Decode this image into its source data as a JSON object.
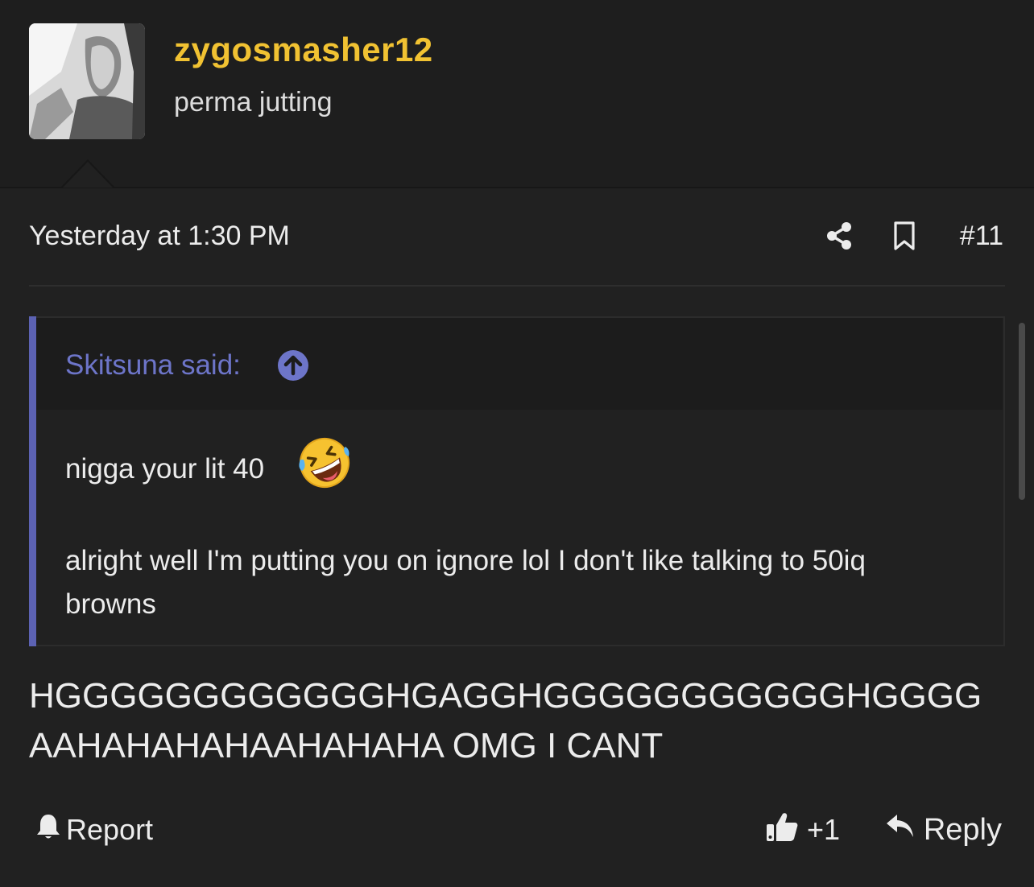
{
  "user": {
    "username": "zygosmasher12",
    "title": "perma jutting"
  },
  "post": {
    "timestamp": "Yesterday at 1:30 PM",
    "number": "#11",
    "body": "HGGGGGGGGGGGGHGAGGHGGGGGGGGGGGHGGGGAAHAHAHAHAAHAHAHA OMG I CANT"
  },
  "quote": {
    "author": "Skitsuna said:",
    "line1": "nigga your lit 40",
    "line2": "alright well I'm putting you on ignore lol I don't like talking to 50iq browns"
  },
  "actions": {
    "report": "Report",
    "like_count": "+1",
    "reply": "Reply"
  },
  "colors": {
    "background": "#212121",
    "username": "#f1c232",
    "quote_accent": "#5c62b3",
    "quote_link": "#6d75c9"
  },
  "icons": [
    "share-icon",
    "bookmark-icon",
    "arrow-up-circle-icon",
    "rofl-emoji-icon",
    "bell-icon",
    "thumbs-up-icon",
    "reply-arrow-icon"
  ]
}
